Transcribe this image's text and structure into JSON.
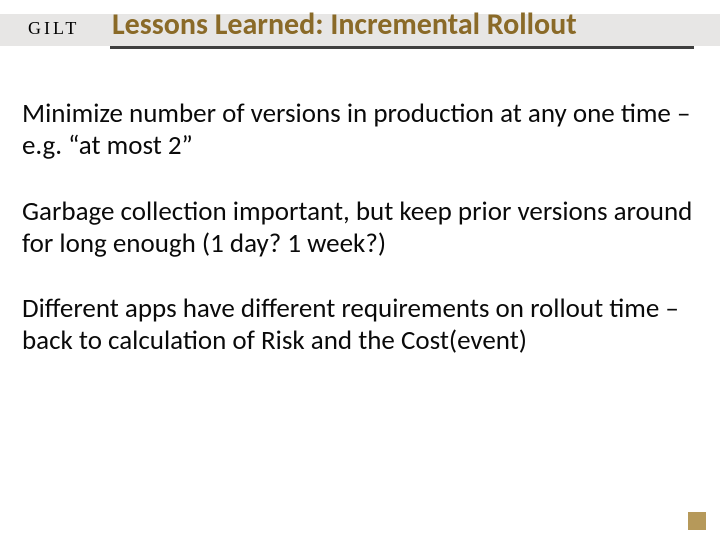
{
  "logo": "GILT",
  "title": "Lessons Learned: Incremental Rollout",
  "paragraphs": [
    "Minimize number of versions in production at any one time – e.g. “at most 2”",
    "Garbage collection important, but keep prior versions around for long enough (1 day? 1 week?)",
    "Different apps have different requirements on rollout time – back to calculation of Risk and the Cost(event)"
  ]
}
